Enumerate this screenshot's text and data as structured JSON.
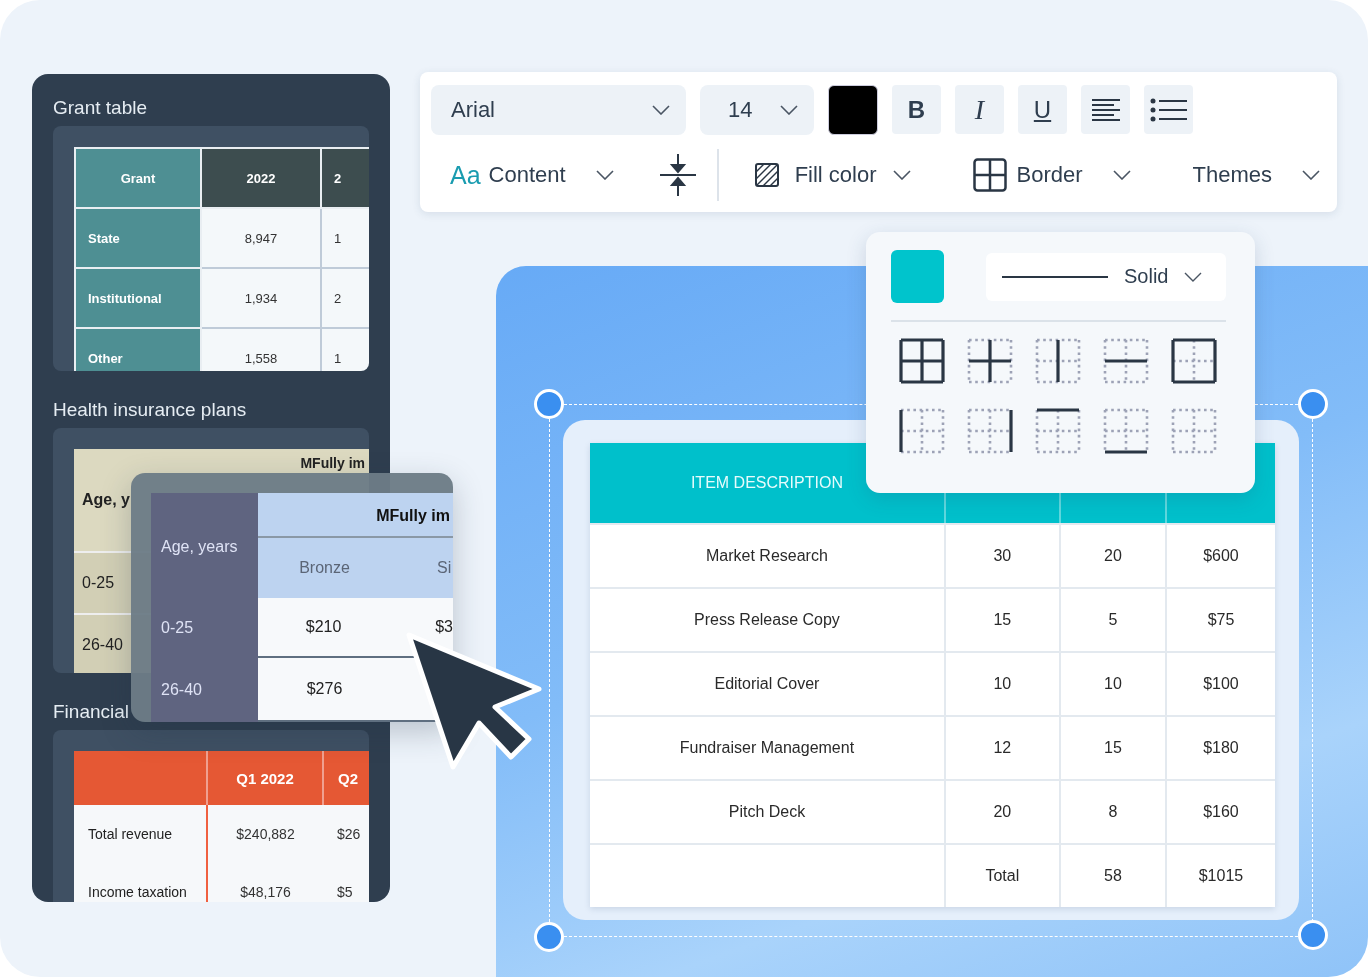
{
  "left_panel": {
    "sections": [
      {
        "kind": "grant",
        "title": "Grant table",
        "header": [
          "Grant",
          "2022",
          "2"
        ],
        "rows": [
          [
            "State",
            "8,947",
            "1"
          ],
          [
            "Institutional",
            "1,934",
            "2"
          ],
          [
            "Other",
            "1,558",
            "1"
          ]
        ]
      },
      {
        "kind": "insurance",
        "title": "Health insurance plans",
        "header": [
          "Age, y",
          "MFully im"
        ],
        "rows": [
          [
            "0-25"
          ],
          [
            "26-40"
          ]
        ]
      },
      {
        "kind": "financial",
        "title": "Financial",
        "header": [
          "Q1 2022",
          "Q2"
        ],
        "rows": [
          [
            "Total revenue",
            "$240,882",
            "$26"
          ],
          [
            "Income taxation",
            "$48,176",
            "$5"
          ]
        ]
      }
    ]
  },
  "overlay_table": {
    "corner": "Age, years",
    "group": "MFully im",
    "subheaders": [
      "Bronze",
      "Si"
    ],
    "rows": [
      {
        "label": "0-25",
        "cells": [
          "$210",
          "$3"
        ]
      },
      {
        "label": "26-40",
        "cells": [
          "$276"
        ]
      }
    ]
  },
  "toolbar": {
    "font": "Arial",
    "size": "14",
    "format_buttons": [
      {
        "kind": "bold",
        "label": "B"
      },
      {
        "kind": "italic",
        "label": "I"
      },
      {
        "kind": "underline",
        "label": "U"
      },
      {
        "kind": "align"
      },
      {
        "kind": "list"
      }
    ],
    "menus": [
      {
        "kind": "content",
        "icon_text": "Aa",
        "label": "Content"
      },
      {
        "kind": "spacing"
      },
      {
        "kind": "fill",
        "label": "Fill color"
      },
      {
        "kind": "border",
        "label": "Border"
      },
      {
        "kind": "themes",
        "label": "Themes"
      }
    ]
  },
  "border_popup": {
    "color": "#00c4cc",
    "line_style": "Solid",
    "options": [
      {
        "kind": "all"
      },
      {
        "kind": "inner"
      },
      {
        "kind": "vertical"
      },
      {
        "kind": "horizontal"
      },
      {
        "kind": "outer"
      },
      {
        "kind": "left"
      },
      {
        "kind": "right"
      },
      {
        "kind": "top"
      },
      {
        "kind": "bottom"
      },
      {
        "kind": "none"
      }
    ]
  },
  "table": {
    "columns": [
      "ITEM DESCRIPTION"
    ],
    "rows": [
      [
        "Market Research",
        "30",
        "20",
        "$600"
      ],
      [
        "Press Release Copy",
        "15",
        "5",
        "$75"
      ],
      [
        "Editorial Cover",
        "10",
        "10",
        "$100"
      ],
      [
        "Fundraiser Management",
        "12",
        "15",
        "$180"
      ],
      [
        "Pitch Deck",
        "20",
        "8",
        "$160"
      ]
    ],
    "total": {
      "label": "Total",
      "quantity": "58",
      "amount": "$1015"
    }
  }
}
